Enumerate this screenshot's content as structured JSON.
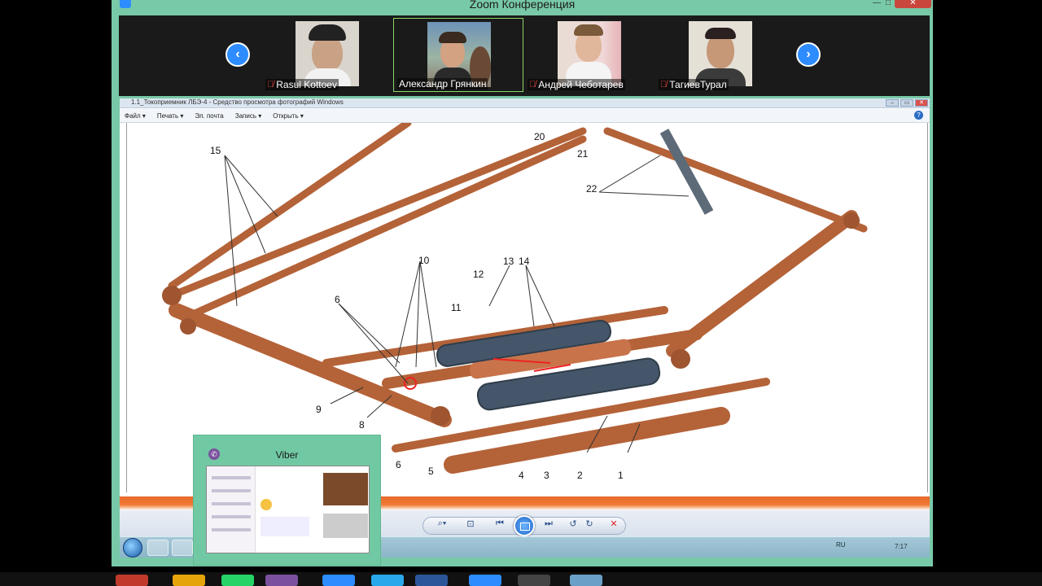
{
  "zoom": {
    "title": "Zoom Конференция",
    "window_controls": {
      "minimize": "—",
      "maximize": "□",
      "close": "✕"
    }
  },
  "participants": [
    {
      "name": "Rasul Kottoev",
      "muted": true
    },
    {
      "name": "Александр Грянкин",
      "muted": false
    },
    {
      "name": "Андрей Чеботарев",
      "muted": true
    },
    {
      "name": "ТагиевТурал",
      "muted": true
    }
  ],
  "nav": {
    "prev": "‹",
    "next": "›"
  },
  "viewer": {
    "title": "1.1_Токоприемник ЛБЭ-4 - Средство просмотра фотографий Windows",
    "menu": [
      "Файл ▾",
      "Печать ▾",
      "Эл. почта",
      "Запись ▾",
      "Открыть ▾"
    ],
    "help": "?",
    "controls": {
      "min": "–",
      "max": "▭",
      "close": "✕"
    }
  },
  "diagram_labels": {
    "l1": "1",
    "l2": "2",
    "l3": "3",
    "l4": "4",
    "l5": "5",
    "l6a": "6",
    "l6b": "6",
    "l8": "8",
    "l9": "9",
    "l10": "10",
    "l11": "11",
    "l12": "12",
    "l13": "13",
    "l14": "14",
    "l15": "15",
    "l20": "20",
    "l21": "21",
    "l22": "22"
  },
  "toolbar": {
    "zoom": "⌕▾",
    "fit": "⊡",
    "prev": "⏮",
    "next": "⏭",
    "rotate_ccw": "↺",
    "rotate_cw": "↻",
    "delete": "✕"
  },
  "inner_taskbar": {
    "lang": "RU",
    "clock": "7:17"
  },
  "viber": {
    "title": "Viber",
    "icon": "✆"
  },
  "colors": {
    "zoom_frame": "#78c9a7",
    "zoom_blue": "#2d8cff",
    "pantograph": "#c8734a",
    "orange_band": "#f07a34"
  }
}
